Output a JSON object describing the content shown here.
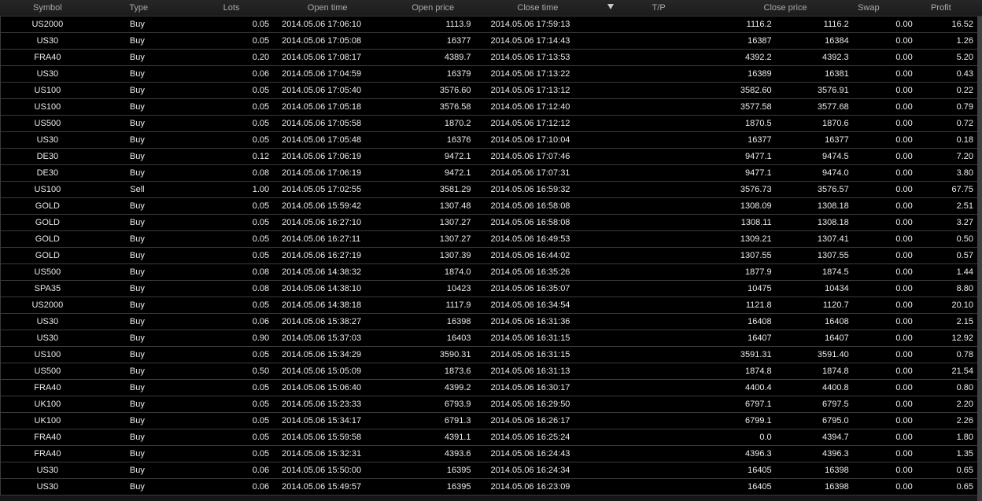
{
  "columns": {
    "symbol": "Symbol",
    "type": "Type",
    "lots": "Lots",
    "open_time": "Open time",
    "open_price": "Open price",
    "close_time": "Close time",
    "tp": "T/P",
    "close_price": "Close price",
    "swap": "Swap",
    "profit": "Profit"
  },
  "sort_icon": "triangle-down-icon",
  "rows": [
    {
      "symbol": "US2000",
      "type": "Buy",
      "lots": "0.05",
      "open_time": "2014.05.06 17:06:10",
      "open_price": "1113.9",
      "close_time": "2014.05.06 17:59:13",
      "tp": "1116.2",
      "close_price": "1116.2",
      "swap": "0.00",
      "profit": "16.52"
    },
    {
      "symbol": "US30",
      "type": "Buy",
      "lots": "0.05",
      "open_time": "2014.05.06 17:05:08",
      "open_price": "16377",
      "close_time": "2014.05.06 17:14:43",
      "tp": "16387",
      "close_price": "16384",
      "swap": "0.00",
      "profit": "1.26"
    },
    {
      "symbol": "FRA40",
      "type": "Buy",
      "lots": "0.20",
      "open_time": "2014.05.06 17:08:17",
      "open_price": "4389.7",
      "close_time": "2014.05.06 17:13:53",
      "tp": "4392.2",
      "close_price": "4392.3",
      "swap": "0.00",
      "profit": "5.20"
    },
    {
      "symbol": "US30",
      "type": "Buy",
      "lots": "0.06",
      "open_time": "2014.05.06 17:04:59",
      "open_price": "16379",
      "close_time": "2014.05.06 17:13:22",
      "tp": "16389",
      "close_price": "16381",
      "swap": "0.00",
      "profit": "0.43"
    },
    {
      "symbol": "US100",
      "type": "Buy",
      "lots": "0.05",
      "open_time": "2014.05.06 17:05:40",
      "open_price": "3576.60",
      "close_time": "2014.05.06 17:13:12",
      "tp": "3582.60",
      "close_price": "3576.91",
      "swap": "0.00",
      "profit": "0.22"
    },
    {
      "symbol": "US100",
      "type": "Buy",
      "lots": "0.05",
      "open_time": "2014.05.06 17:05:18",
      "open_price": "3576.58",
      "close_time": "2014.05.06 17:12:40",
      "tp": "3577.58",
      "close_price": "3577.68",
      "swap": "0.00",
      "profit": "0.79"
    },
    {
      "symbol": "US500",
      "type": "Buy",
      "lots": "0.05",
      "open_time": "2014.05.06 17:05:58",
      "open_price": "1870.2",
      "close_time": "2014.05.06 17:12:12",
      "tp": "1870.5",
      "close_price": "1870.6",
      "swap": "0.00",
      "profit": "0.72"
    },
    {
      "symbol": "US30",
      "type": "Buy",
      "lots": "0.05",
      "open_time": "2014.05.06 17:05:48",
      "open_price": "16376",
      "close_time": "2014.05.06 17:10:04",
      "tp": "16377",
      "close_price": "16377",
      "swap": "0.00",
      "profit": "0.18"
    },
    {
      "symbol": "DE30",
      "type": "Buy",
      "lots": "0.12",
      "open_time": "2014.05.06 17:06:19",
      "open_price": "9472.1",
      "close_time": "2014.05.06 17:07:46",
      "tp": "9477.1",
      "close_price": "9474.5",
      "swap": "0.00",
      "profit": "7.20"
    },
    {
      "symbol": "DE30",
      "type": "Buy",
      "lots": "0.08",
      "open_time": "2014.05.06 17:06:19",
      "open_price": "9472.1",
      "close_time": "2014.05.06 17:07:31",
      "tp": "9477.1",
      "close_price": "9474.0",
      "swap": "0.00",
      "profit": "3.80"
    },
    {
      "symbol": "US100",
      "type": "Sell",
      "lots": "1.00",
      "open_time": "2014.05.05 17:02:55",
      "open_price": "3581.29",
      "close_time": "2014.05.06 16:59:32",
      "tp": "3576.73",
      "close_price": "3576.57",
      "swap": "0.00",
      "profit": "67.75"
    },
    {
      "symbol": "GOLD",
      "type": "Buy",
      "lots": "0.05",
      "open_time": "2014.05.06 15:59:42",
      "open_price": "1307.48",
      "close_time": "2014.05.06 16:58:08",
      "tp": "1308.09",
      "close_price": "1308.18",
      "swap": "0.00",
      "profit": "2.51"
    },
    {
      "symbol": "GOLD",
      "type": "Buy",
      "lots": "0.05",
      "open_time": "2014.05.06 16:27:10",
      "open_price": "1307.27",
      "close_time": "2014.05.06 16:58:08",
      "tp": "1308.11",
      "close_price": "1308.18",
      "swap": "0.00",
      "profit": "3.27"
    },
    {
      "symbol": "GOLD",
      "type": "Buy",
      "lots": "0.05",
      "open_time": "2014.05.06 16:27:11",
      "open_price": "1307.27",
      "close_time": "2014.05.06 16:49:53",
      "tp": "1309.21",
      "close_price": "1307.41",
      "swap": "0.00",
      "profit": "0.50"
    },
    {
      "symbol": "GOLD",
      "type": "Buy",
      "lots": "0.05",
      "open_time": "2014.05.06 16:27:19",
      "open_price": "1307.39",
      "close_time": "2014.05.06 16:44:02",
      "tp": "1307.55",
      "close_price": "1307.55",
      "swap": "0.00",
      "profit": "0.57"
    },
    {
      "symbol": "US500",
      "type": "Buy",
      "lots": "0.08",
      "open_time": "2014.05.06 14:38:32",
      "open_price": "1874.0",
      "close_time": "2014.05.06 16:35:26",
      "tp": "1877.9",
      "close_price": "1874.5",
      "swap": "0.00",
      "profit": "1.44"
    },
    {
      "symbol": "SPA35",
      "type": "Buy",
      "lots": "0.08",
      "open_time": "2014.05.06 14:38:10",
      "open_price": "10423",
      "close_time": "2014.05.06 16:35:07",
      "tp": "10475",
      "close_price": "10434",
      "swap": "0.00",
      "profit": "8.80"
    },
    {
      "symbol": "US2000",
      "type": "Buy",
      "lots": "0.05",
      "open_time": "2014.05.06 14:38:18",
      "open_price": "1117.9",
      "close_time": "2014.05.06 16:34:54",
      "tp": "1121.8",
      "close_price": "1120.7",
      "swap": "0.00",
      "profit": "20.10"
    },
    {
      "symbol": "US30",
      "type": "Buy",
      "lots": "0.06",
      "open_time": "2014.05.06 15:38:27",
      "open_price": "16398",
      "close_time": "2014.05.06 16:31:36",
      "tp": "16408",
      "close_price": "16408",
      "swap": "0.00",
      "profit": "2.15"
    },
    {
      "symbol": "US30",
      "type": "Buy",
      "lots": "0.90",
      "open_time": "2014.05.06 15:37:03",
      "open_price": "16403",
      "close_time": "2014.05.06 16:31:15",
      "tp": "16407",
      "close_price": "16407",
      "swap": "0.00",
      "profit": "12.92"
    },
    {
      "symbol": "US100",
      "type": "Buy",
      "lots": "0.05",
      "open_time": "2014.05.06 15:34:29",
      "open_price": "3590.31",
      "close_time": "2014.05.06 16:31:15",
      "tp": "3591.31",
      "close_price": "3591.40",
      "swap": "0.00",
      "profit": "0.78"
    },
    {
      "symbol": "US500",
      "type": "Buy",
      "lots": "0.50",
      "open_time": "2014.05.06 15:05:09",
      "open_price": "1873.6",
      "close_time": "2014.05.06 16:31:13",
      "tp": "1874.8",
      "close_price": "1874.8",
      "swap": "0.00",
      "profit": "21.54"
    },
    {
      "symbol": "FRA40",
      "type": "Buy",
      "lots": "0.05",
      "open_time": "2014.05.06 15:06:40",
      "open_price": "4399.2",
      "close_time": "2014.05.06 16:30:17",
      "tp": "4400.4",
      "close_price": "4400.8",
      "swap": "0.00",
      "profit": "0.80"
    },
    {
      "symbol": "UK100",
      "type": "Buy",
      "lots": "0.05",
      "open_time": "2014.05.06 15:23:33",
      "open_price": "6793.9",
      "close_time": "2014.05.06 16:29:50",
      "tp": "6797.1",
      "close_price": "6797.5",
      "swap": "0.00",
      "profit": "2.20"
    },
    {
      "symbol": "UK100",
      "type": "Buy",
      "lots": "0.05",
      "open_time": "2014.05.06 15:34:17",
      "open_price": "6791.3",
      "close_time": "2014.05.06 16:26:17",
      "tp": "6799.1",
      "close_price": "6795.0",
      "swap": "0.00",
      "profit": "2.26"
    },
    {
      "symbol": "FRA40",
      "type": "Buy",
      "lots": "0.05",
      "open_time": "2014.05.06 15:59:58",
      "open_price": "4391.1",
      "close_time": "2014.05.06 16:25:24",
      "tp": "0.0",
      "close_price": "4394.7",
      "swap": "0.00",
      "profit": "1.80"
    },
    {
      "symbol": "FRA40",
      "type": "Buy",
      "lots": "0.05",
      "open_time": "2014.05.06 15:32:31",
      "open_price": "4393.6",
      "close_time": "2014.05.06 16:24:43",
      "tp": "4396.3",
      "close_price": "4396.3",
      "swap": "0.00",
      "profit": "1.35"
    },
    {
      "symbol": "US30",
      "type": "Buy",
      "lots": "0.06",
      "open_time": "2014.05.06 15:50:00",
      "open_price": "16395",
      "close_time": "2014.05.06 16:24:34",
      "tp": "16405",
      "close_price": "16398",
      "swap": "0.00",
      "profit": "0.65"
    },
    {
      "symbol": "US30",
      "type": "Buy",
      "lots": "0.06",
      "open_time": "2014.05.06 15:49:57",
      "open_price": "16395",
      "close_time": "2014.05.06 16:23:09",
      "tp": "16405",
      "close_price": "16398",
      "swap": "0.00",
      "profit": "0.65"
    }
  ]
}
